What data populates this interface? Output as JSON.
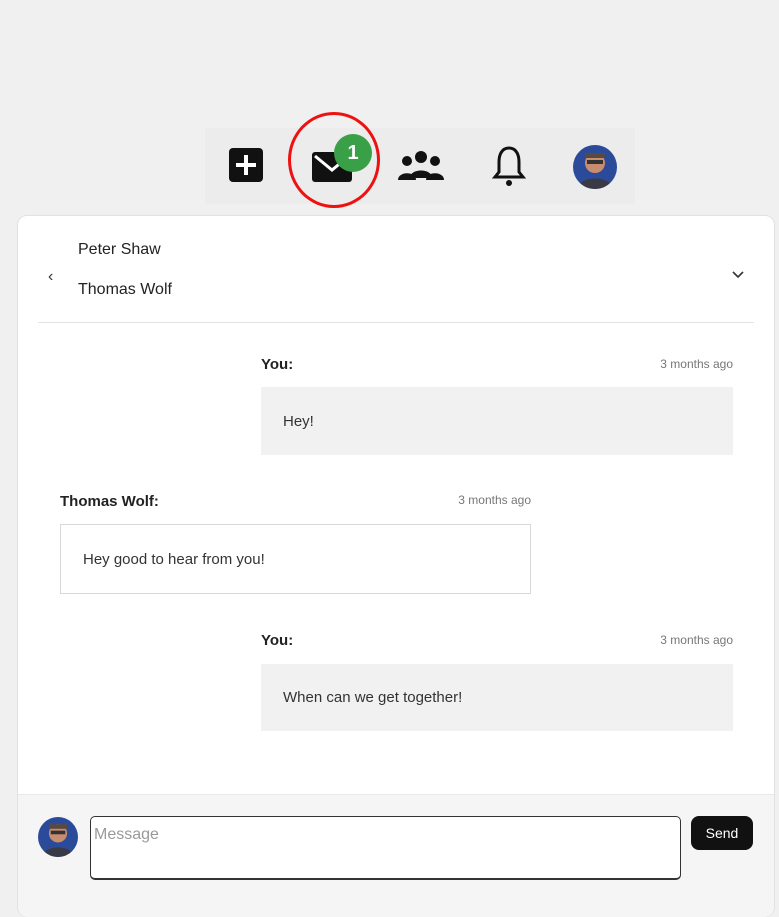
{
  "nav": {
    "icons": [
      "plus-square-icon",
      "mail-icon",
      "group-icon",
      "bell-icon",
      "user-avatar"
    ],
    "unread_badge": "1",
    "highlight_color": "#e11111",
    "badge_color": "#3aa047"
  },
  "conversation": {
    "participants": [
      "Peter Shaw",
      "Thomas Wolf"
    ],
    "messages": [
      {
        "sender": "You:",
        "time": "3 months ago",
        "text": "Hey!"
      },
      {
        "sender": "Thomas Wolf:",
        "time": "3 months ago",
        "text": "Hey good to hear from you!"
      },
      {
        "sender": "You:",
        "time": "3 months ago",
        "text": "When can we get together!"
      }
    ]
  },
  "composer": {
    "placeholder": "Message",
    "value": "",
    "send_label": "Send"
  }
}
